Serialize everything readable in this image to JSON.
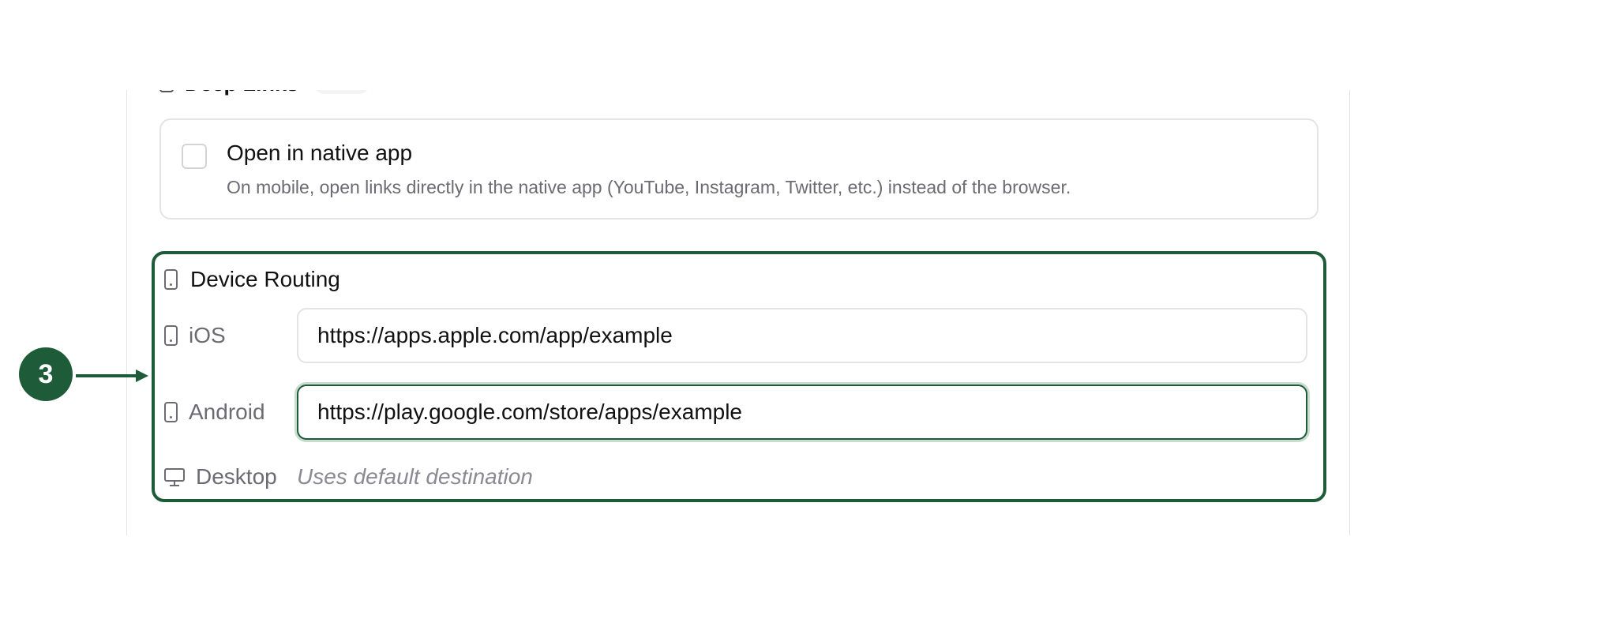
{
  "deep_links": {
    "label": "Deep Links"
  },
  "native_app": {
    "title": "Open in native app",
    "description": "On mobile, open links directly in the native app (YouTube, Instagram, Twitter, etc.) instead of the browser.",
    "checked": false
  },
  "device_routing": {
    "title": "Device Routing",
    "ios": {
      "label": "iOS",
      "value": "https://apps.apple.com/app/example"
    },
    "android": {
      "label": "Android",
      "value": "https://play.google.com/store/apps/example"
    },
    "desktop": {
      "label": "Desktop",
      "default_text": "Uses default destination"
    }
  },
  "annotation": {
    "number": "3"
  },
  "colors": {
    "accent": "#1e5b38",
    "border": "#e4e4e7",
    "muted_text": "#6b6b73"
  },
  "icons": {
    "device": "smartphone-icon",
    "desktop": "monitor-icon",
    "checkbox": "checkbox-empty"
  }
}
